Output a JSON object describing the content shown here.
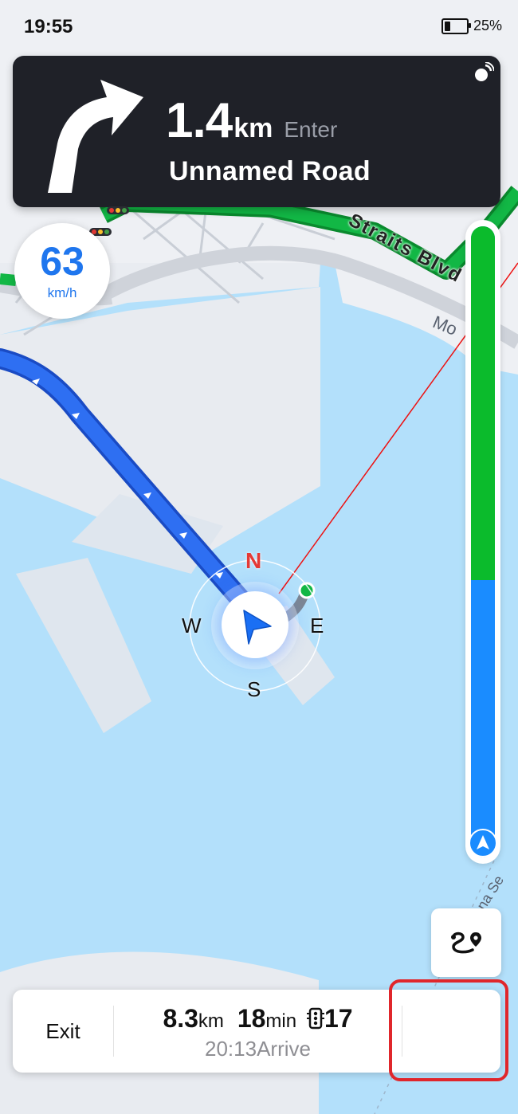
{
  "status_bar": {
    "time": "19:55",
    "battery_percent": "25%",
    "battery_level": 0.25
  },
  "maneuver": {
    "distance_value": "1.4",
    "distance_unit": "km",
    "action": "Enter",
    "road_name": "Unnamed Road",
    "turn_icon": "turn-right-arrow-icon"
  },
  "speed": {
    "value": "63",
    "unit": "km/h"
  },
  "map_labels": {
    "road1": "Straits Blvd",
    "road2": "Mo",
    "road3": "na Se"
  },
  "compass": {
    "north": "N",
    "east": "E",
    "south": "S",
    "west": "W"
  },
  "route_progress": {
    "green_fraction": 0.56,
    "colors": {
      "clear": "#0bbb2c",
      "remaining": "#1a8cff"
    }
  },
  "trip": {
    "exit_label": "Exit",
    "distance_value": "8.3",
    "distance_unit": "km",
    "time_value": "18",
    "time_unit": "min",
    "traffic_lights": "17",
    "arrive_time": "20:13",
    "arrive_label": "Arrive"
  },
  "colors": {
    "route_blue": "#2e6ff2",
    "traffic_green": "#12b745",
    "accent_red": "#e0262b"
  }
}
